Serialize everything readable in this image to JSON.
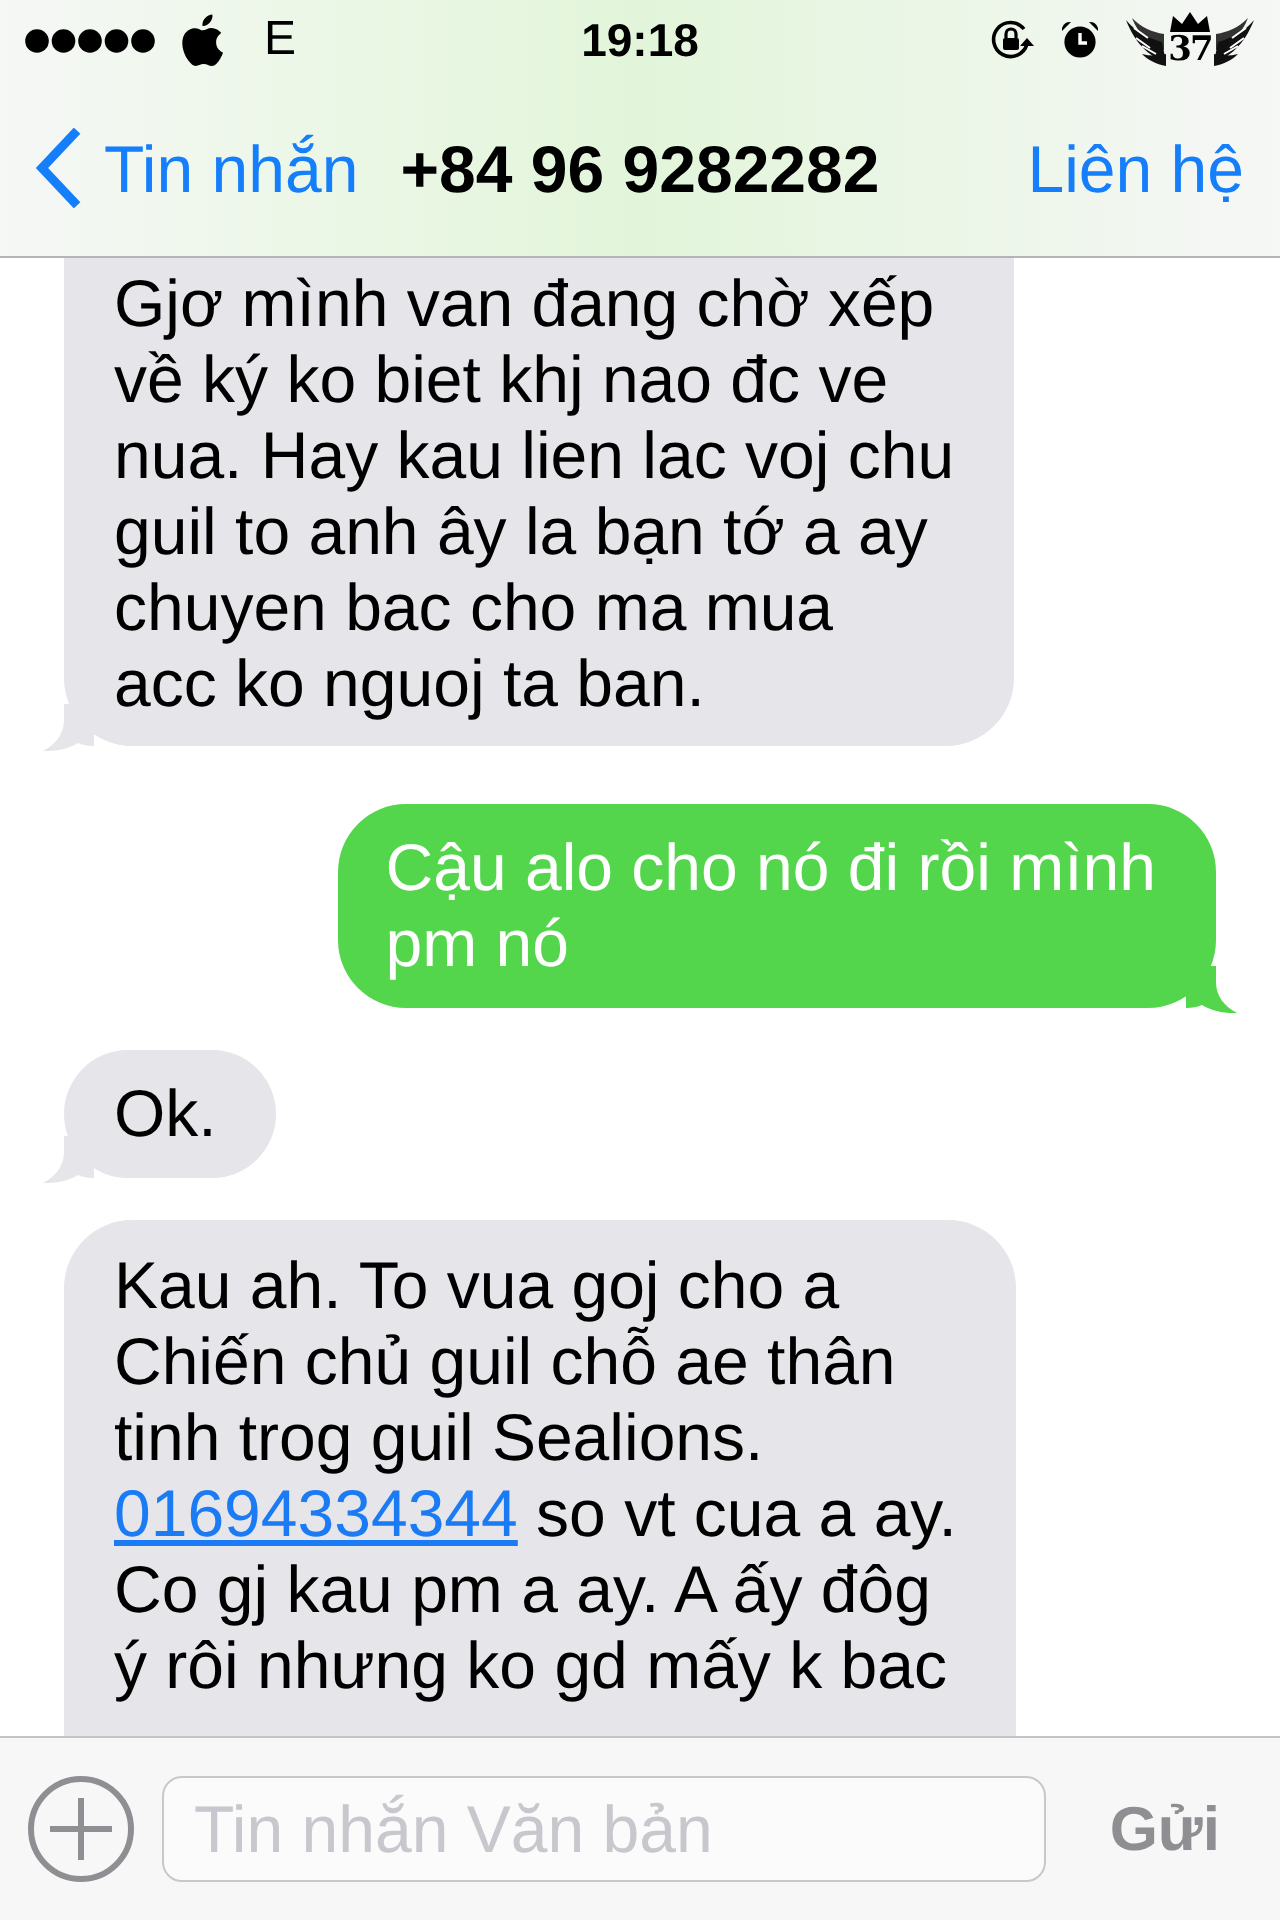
{
  "status_bar": {
    "network": "E",
    "time": "19:18",
    "logo_text": "37"
  },
  "nav_bar": {
    "back_label": "Tin nhắn",
    "title": "+84 96 9282282",
    "action_label": "Liên hệ"
  },
  "messages": [
    {
      "kind": "received",
      "cut_top": true,
      "tail": true,
      "lines": [
        [
          {
            "kind": "text",
            "text": "Gjơ mình van đang chờ xếp"
          }
        ],
        [
          {
            "kind": "text",
            "text": "về ký ko biet khj nao đc ve"
          }
        ],
        [
          {
            "kind": "text",
            "text": "nua. Hay kau lien lac voj chu"
          }
        ],
        [
          {
            "kind": "text",
            "text": "guil to anh ây la bạn tớ a ay"
          }
        ],
        [
          {
            "kind": "text",
            "text": "chuyen bac cho ma mua"
          }
        ],
        [
          {
            "kind": "text",
            "text": "acc ko nguoj ta ban."
          }
        ]
      ]
    },
    {
      "kind": "sent",
      "tail": true,
      "lines": [
        [
          {
            "kind": "text",
            "text": "Cậu alo cho nó đi rồi mình"
          }
        ],
        [
          {
            "kind": "text",
            "text": "pm nó"
          }
        ]
      ]
    },
    {
      "kind": "received",
      "tail": true,
      "lines": [
        [
          {
            "kind": "text",
            "text": "Ok."
          }
        ]
      ]
    },
    {
      "kind": "received",
      "cut_bottom": true,
      "tail": false,
      "lines": [
        [
          {
            "kind": "text",
            "text": "Kau ah. To vua goj cho a"
          }
        ],
        [
          {
            "kind": "text",
            "text": "Chiến chủ guil chỗ ae thân"
          }
        ],
        [
          {
            "kind": "text",
            "text": "tinh trog guil Sealions."
          }
        ],
        [
          {
            "kind": "link",
            "text": "01694334344"
          },
          {
            "kind": "text",
            "text": " so vt cua a ay."
          }
        ],
        [
          {
            "kind": "text",
            "text": "Co gj kau pm a ay. A ấy đôg"
          }
        ],
        [
          {
            "kind": "text",
            "text": "ý rôi nhưng ko gd mấy k bac"
          }
        ]
      ]
    }
  ],
  "composer": {
    "placeholder": "Tin nhắn Văn bản",
    "send": {
      "label": "Gửi",
      "disabled": true
    }
  }
}
